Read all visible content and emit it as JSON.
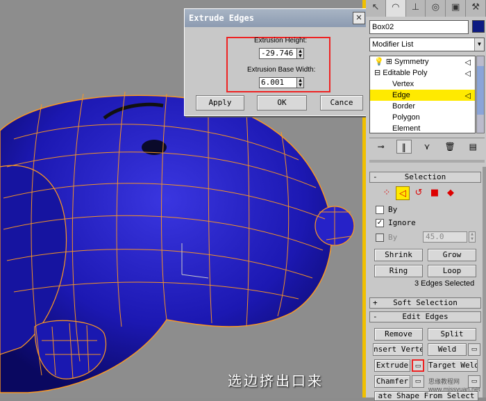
{
  "dialog": {
    "title": "Extrude Edges",
    "close_label": "X",
    "height_label": "Extrusion Height:",
    "height_value": "-29.746",
    "width_label": "Extrusion Base Width:",
    "width_value": "6.001",
    "apply_label": "Apply",
    "ok_label": "OK",
    "cancel_label": "Cance"
  },
  "caption": "选边挤出口来",
  "panel": {
    "tabs": [
      "arrow-cursor-icon",
      "bend-icon",
      "hierarchy-icon",
      "motion-icon",
      "display-icon",
      "utilities-icon"
    ],
    "object_name": "Box02",
    "object_color": "#0d1b82",
    "modifier_list": "Modifier List",
    "stack": [
      {
        "label": "Symmetry",
        "prefix": "💡 ⊞"
      },
      {
        "label": "Editable Poly",
        "prefix": "⊟"
      },
      {
        "label": "Vertex",
        "prefix": "   ⋯"
      },
      {
        "label": "Edge",
        "prefix": "   ⋯"
      },
      {
        "label": "Border",
        "prefix": "   ⋯"
      },
      {
        "label": "Polygon",
        "prefix": "   ⋯"
      },
      {
        "label": "Element",
        "prefix": "   ⋯"
      }
    ],
    "selection": {
      "header": "Selection",
      "by_vertex": "By",
      "ignore_backfacing": "Ignore",
      "by_angle": "By",
      "angle_value": "45.0",
      "shrink": "Shrink",
      "grow": "Grow",
      "ring": "Ring",
      "loop": "Loop",
      "status": "3 Edges Selected"
    },
    "soft_selection": {
      "header": "Soft Selection",
      "toggle": "+"
    },
    "edit_edges": {
      "header": "Edit Edges",
      "toggle": "-",
      "remove": "Remove",
      "split": "Split",
      "insert_vertex": "nsert Verte",
      "weld": "Weld",
      "extrude": "Extrude",
      "target_weld": "Target Weld",
      "chamfer": "Chamfer",
      "create_shape": "ate Shape From Select"
    }
  },
  "watermark": "思缘教程网 www.missyuan.net",
  "colors": {
    "highlight": "#ffea00",
    "accent_red": "#e22222",
    "model_blue": "#1a18b0",
    "wire": "#ff9a20"
  }
}
